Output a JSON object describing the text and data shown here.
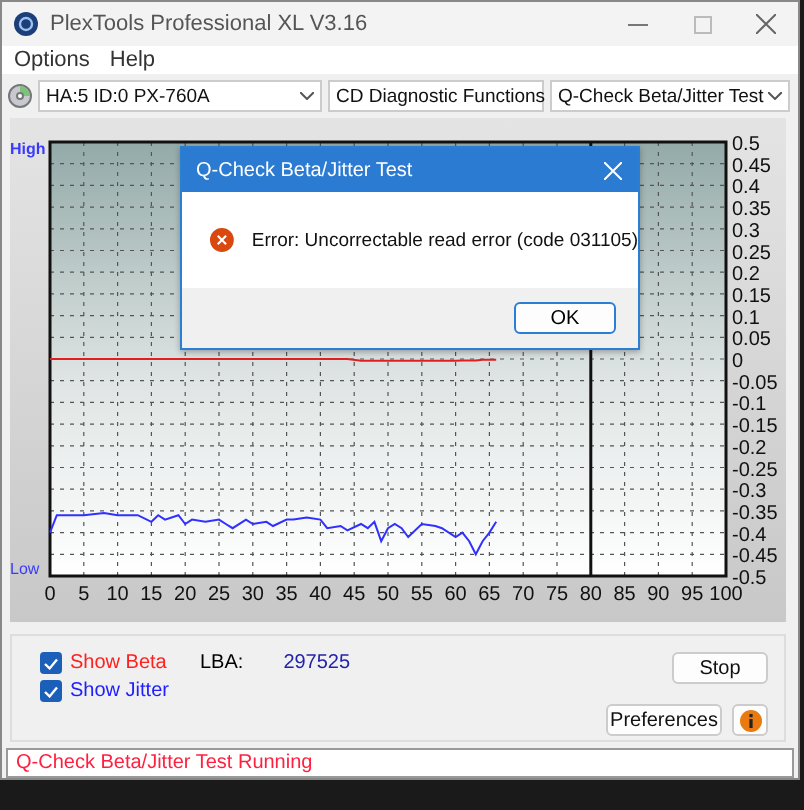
{
  "window": {
    "title": "PlexTools Professional XL V3.16"
  },
  "menu": [
    {
      "label": "Options"
    },
    {
      "label": "Help"
    }
  ],
  "selectors": [
    {
      "kind": "drive",
      "value": "HA:5 ID:0  PX-760A"
    },
    {
      "kind": "plain",
      "value": "CD Diagnostic Functions"
    },
    {
      "kind": "plain",
      "value": "Q-Check Beta/Jitter Test"
    }
  ],
  "chart": {
    "high_label": "High",
    "low_label": "Low",
    "chart_data": {
      "type": "line",
      "x": [
        0,
        1,
        3,
        5,
        8,
        10,
        13,
        15,
        16,
        17,
        19,
        20,
        21,
        23,
        25,
        26,
        27,
        29,
        30,
        32,
        33,
        35,
        36,
        38,
        40,
        41,
        43,
        44,
        46,
        47,
        48,
        49,
        50,
        51,
        52,
        53,
        55,
        57,
        58,
        60,
        61,
        62,
        63,
        64,
        65,
        66
      ],
      "series": [
        {
          "color": "#e02020",
          "values": [
            0,
            0,
            0,
            0,
            0,
            0,
            0,
            0,
            0,
            0,
            0,
            0,
            0,
            0,
            0,
            0,
            0,
            0,
            0,
            0,
            0,
            0,
            0,
            0,
            0,
            0,
            0,
            0,
            -0.004,
            -0.004,
            -0.004,
            -0.004,
            -0.004,
            -0.004,
            -0.004,
            -0.004,
            -0.004,
            -0.004,
            -0.004,
            -0.004,
            -0.003,
            -0.003,
            -0.003,
            -0.002,
            -0.002,
            -0.002
          ]
        },
        {
          "color": "#3030ff",
          "values": [
            -0.4,
            -0.36,
            -0.36,
            -0.36,
            -0.355,
            -0.36,
            -0.36,
            -0.375,
            -0.36,
            -0.37,
            -0.36,
            -0.38,
            -0.37,
            -0.375,
            -0.37,
            -0.38,
            -0.39,
            -0.37,
            -0.38,
            -0.375,
            -0.385,
            -0.37,
            -0.37,
            -0.365,
            -0.37,
            -0.39,
            -0.385,
            -0.395,
            -0.38,
            -0.39,
            -0.375,
            -0.42,
            -0.39,
            -0.38,
            -0.39,
            -0.41,
            -0.38,
            -0.385,
            -0.39,
            -0.41,
            -0.4,
            -0.42,
            -0.45,
            -0.42,
            -0.4,
            -0.375
          ]
        }
      ],
      "xlim": [
        0,
        100
      ],
      "ylim": [
        -0.5,
        0.5
      ],
      "xticks": [
        0,
        5,
        10,
        15,
        20,
        25,
        30,
        35,
        40,
        45,
        50,
        55,
        60,
        65,
        70,
        75,
        80,
        85,
        90,
        95,
        100
      ],
      "yticks": [
        0.5,
        0.45,
        0.4,
        0.35,
        0.3,
        0.25,
        0.2,
        0.15,
        0.1,
        0.05,
        0,
        -0.05,
        -0.1,
        -0.15,
        -0.2,
        -0.25,
        -0.3,
        -0.35,
        -0.4,
        -0.45,
        -0.5
      ],
      "grid": true,
      "ref_lines": [
        {
          "axis": "x",
          "value": 80
        }
      ]
    }
  },
  "options": [
    {
      "label": "Show Beta",
      "checked": true,
      "color": "#ff2020"
    },
    {
      "label": "Show Jitter",
      "checked": true,
      "color": "#2020ff"
    }
  ],
  "lba": {
    "label": "LBA:",
    "value": "297525"
  },
  "buttons": {
    "stop": "Stop",
    "preferences": "Preferences"
  },
  "status_bar": "Q-Check Beta/Jitter Test Running",
  "dialog": {
    "title": "Q-Check Beta/Jitter Test",
    "message": "Error: Uncorrectable read error (code 031105)",
    "button": "OK"
  }
}
